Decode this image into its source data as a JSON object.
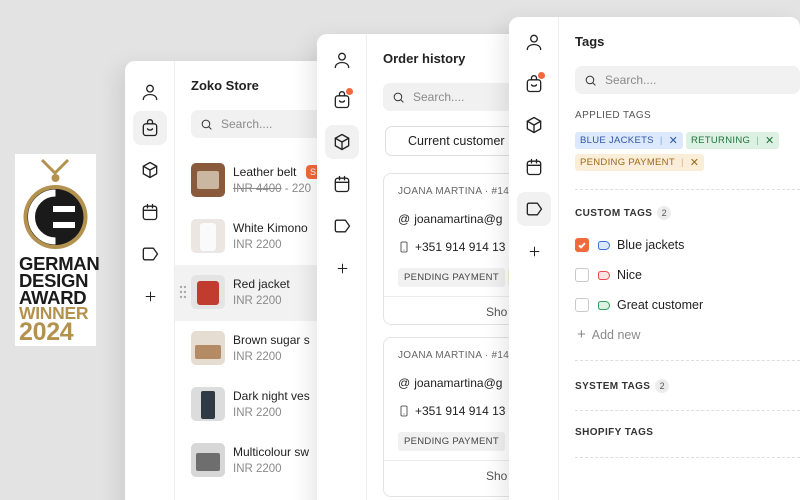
{
  "award": {
    "line1": "GERMAN",
    "line2": "DESIGN",
    "line3": "AWARD",
    "line4": "WINNER",
    "line5": "2024"
  },
  "colors": {
    "accent": "#f06b3c",
    "gold": "#b3924f",
    "blue_tag": "#dce8fb",
    "green_tag": "#dcf1e2",
    "orange_tag": "#fbeed8"
  },
  "store": {
    "title": "Zoko Store",
    "search_placeholder": "Search....",
    "products": [
      {
        "name": "Leather belt",
        "price_strike": "INR 4400",
        "price": "- 220",
        "badge": "S"
      },
      {
        "name": "White Kimono",
        "price": "INR 2200"
      },
      {
        "name": "Red jacket",
        "price": "INR 2200"
      },
      {
        "name": "Brown sugar s",
        "price": "INR 2200"
      },
      {
        "name": "Dark night ves",
        "price": "INR 2200"
      },
      {
        "name": "Multicolour sw",
        "price": "INR 2200"
      }
    ]
  },
  "orders": {
    "title": "Order history",
    "search_placeholder": "Search....",
    "tab_label": "Current customer",
    "cards": [
      {
        "name": "JOANA MARTINA · #144",
        "email": "joanamartina@g",
        "phone": "+351 914 914 13",
        "badge": "PENDING PAYMENT",
        "show": "Sho"
      },
      {
        "name": "JOANA MARTINA · #144",
        "email": "joanamartina@g",
        "phone": "+351 914 914 13",
        "badge": "PENDING PAYMENT",
        "show": "Sho"
      }
    ]
  },
  "tags": {
    "title": "Tags",
    "search_placeholder": "Search....",
    "applied_label": "APPLIED TAGS",
    "applied": [
      {
        "label": "BLUE JACKETS"
      },
      {
        "label": "RETURNING"
      },
      {
        "label": "PENDING PAYMENT"
      }
    ],
    "custom_label": "CUSTOM TAGS",
    "custom_count": "2",
    "custom": [
      {
        "label": "Blue jackets",
        "checked": true,
        "color": "#3b6fd8"
      },
      {
        "label": "Nice",
        "checked": false,
        "color": "#e8474f"
      },
      {
        "label": "Great customer",
        "checked": false,
        "color": "#2f9d5b"
      }
    ],
    "add_new": "Add new",
    "system_label": "SYSTEM TAGS",
    "system_count": "2",
    "shopify_label": "SHOPIFY TAGS"
  }
}
